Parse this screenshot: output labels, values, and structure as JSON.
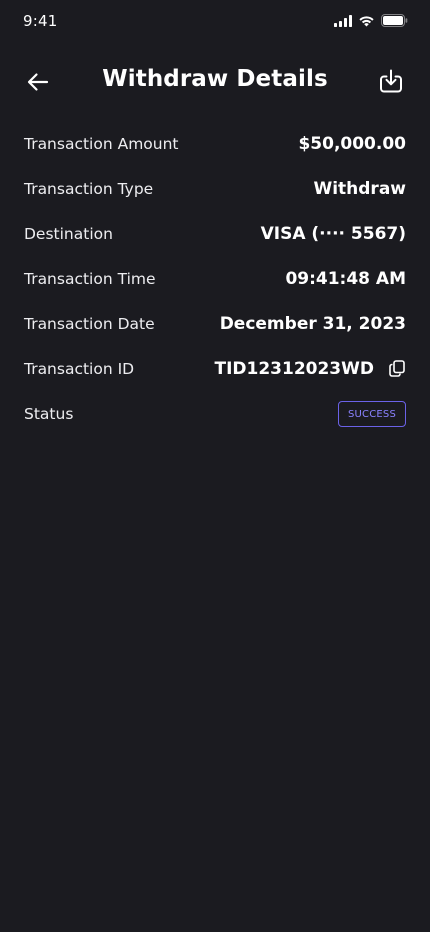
{
  "status_bar": {
    "time": "9:41"
  },
  "header": {
    "title": "Withdraw Details",
    "back_icon": "arrow-left-icon",
    "download_icon": "download-icon"
  },
  "details": [
    {
      "label": "Transaction Amount",
      "value": "$50,000.00"
    },
    {
      "label": "Transaction Type",
      "value": "Withdraw"
    },
    {
      "label": "Destination",
      "value": "VISA (···· 5567)"
    },
    {
      "label": "Transaction Time",
      "value": "09:41:48 AM"
    },
    {
      "label": "Transaction Date",
      "value": "December 31, 2023"
    },
    {
      "label": "Transaction ID",
      "value": "TID12312023WD",
      "icon": "copy-icon"
    },
    {
      "label": "Status",
      "value": "SUCCESS"
    }
  ],
  "colors": {
    "background": "#1b1b20",
    "text": "#ffffff",
    "badge_accent": "#8a82ff"
  }
}
